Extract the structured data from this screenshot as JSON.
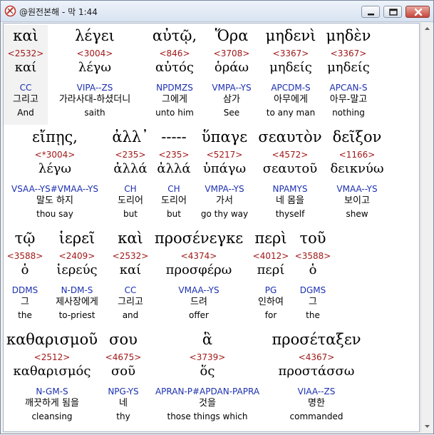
{
  "window": {
    "title": "@원전본해 - 막 1:44"
  },
  "rows": [
    {
      "words": [
        {
          "greek": "καὶ",
          "strong": "<2532>",
          "lemma": "καί",
          "parse": "CC",
          "korean": "그리고",
          "english": "And"
        },
        {
          "greek": "λέγει",
          "strong": "<3004>",
          "lemma": "λέγω",
          "parse": "VIPA--ZS",
          "korean": "가라사대-하셨더니",
          "english": "saith"
        },
        {
          "greek": "αὐτῷ,",
          "strong": "<846>",
          "lemma": "αὐτός",
          "parse": "NPDMZS",
          "korean": "그에게",
          "english": "unto him"
        },
        {
          "greek": "Ὅρα",
          "strong": "<3708>",
          "lemma": "ὁράω",
          "parse": "VMPA--YS",
          "korean": "삼가",
          "english": "See"
        },
        {
          "greek": "μηδενὶ",
          "strong": "<3367>",
          "lemma": "μηδείς",
          "parse": "APCDM-S",
          "korean": "아무에게",
          "english": "to any man"
        },
        {
          "greek": "μηδὲν",
          "strong": "<3367>",
          "lemma": "μηδείς",
          "parse": "APCAN-S",
          "korean": "아무-말고",
          "english": "nothing"
        }
      ]
    },
    {
      "words": [
        {
          "greek": "εἴπῃς,",
          "strong": "<*3004>",
          "lemma": "λέγω",
          "parse": "VSAA--YS#VMAA--YS",
          "korean": "말도 하지",
          "english": "thou say"
        },
        {
          "greek": "ἀλλ᾽",
          "strong": "<235>",
          "lemma": "ἀλλά",
          "parse": "CH",
          "korean": "도리어",
          "english": "but"
        },
        {
          "greek": "-----",
          "strong": "<235>",
          "lemma": "ἀλλά",
          "parse": "CH",
          "korean": "도리어",
          "english": "but"
        },
        {
          "greek": "ὕπαγε",
          "strong": "<5217>",
          "lemma": "ὑπάγω",
          "parse": "VMPA--YS",
          "korean": "가서",
          "english": "go thy way"
        },
        {
          "greek": "σεαυτὸν",
          "strong": "<4572>",
          "lemma": "σεαυτοῦ",
          "parse": "NPAMYS",
          "korean": "네 몸을",
          "english": "thyself"
        },
        {
          "greek": "δεῖξον",
          "strong": "<1166>",
          "lemma": "δεικνύω",
          "parse": "VMAA--YS",
          "korean": "보이고",
          "english": "shew"
        }
      ]
    },
    {
      "words": [
        {
          "greek": "τῷ",
          "strong": "<3588>",
          "lemma": "ὁ",
          "parse": "DDMS",
          "korean": "그",
          "english": "the"
        },
        {
          "greek": "ἱερεῖ",
          "strong": "<2409>",
          "lemma": "ἱερεύς",
          "parse": "N-DM-S",
          "korean": "제사장에게",
          "english": "to-priest"
        },
        {
          "greek": "καὶ",
          "strong": "<2532>",
          "lemma": "καί",
          "parse": "CC",
          "korean": "그리고",
          "english": "and"
        },
        {
          "greek": "προσένεγκε",
          "strong": "<4374>",
          "lemma": "προσφέρω",
          "parse": "VMAA--YS",
          "korean": "드려",
          "english": "offer"
        },
        {
          "greek": "περὶ",
          "strong": "<4012>",
          "lemma": "περί",
          "parse": "PG",
          "korean": "인하여",
          "english": "for"
        },
        {
          "greek": "τοῦ",
          "strong": "<3588>",
          "lemma": "ὁ",
          "parse": "DGMS",
          "korean": "그",
          "english": "the"
        }
      ]
    },
    {
      "words": [
        {
          "greek": "καθαρισμοῦ",
          "strong": "<2512>",
          "lemma": "καθαρισμός",
          "parse": "N-GM-S",
          "korean": "깨끗하게 됨을",
          "english": "cleansing"
        },
        {
          "greek": "σου",
          "strong": "<4675>",
          "lemma": "σοῦ",
          "parse": "NPG-YS",
          "korean": "네",
          "english": "thy"
        },
        {
          "greek": "ἃ",
          "strong": "<3739>",
          "lemma": "ὅς",
          "parse": "APRAN-P#APDAN-PAPRA",
          "korean": "것을",
          "english": "those things which"
        },
        {
          "greek": "προσέταξεν",
          "strong": "<4367>",
          "lemma": "προστάσσω",
          "parse": "VIAA--ZS",
          "korean": "명한",
          "english": "commanded"
        }
      ]
    }
  ]
}
